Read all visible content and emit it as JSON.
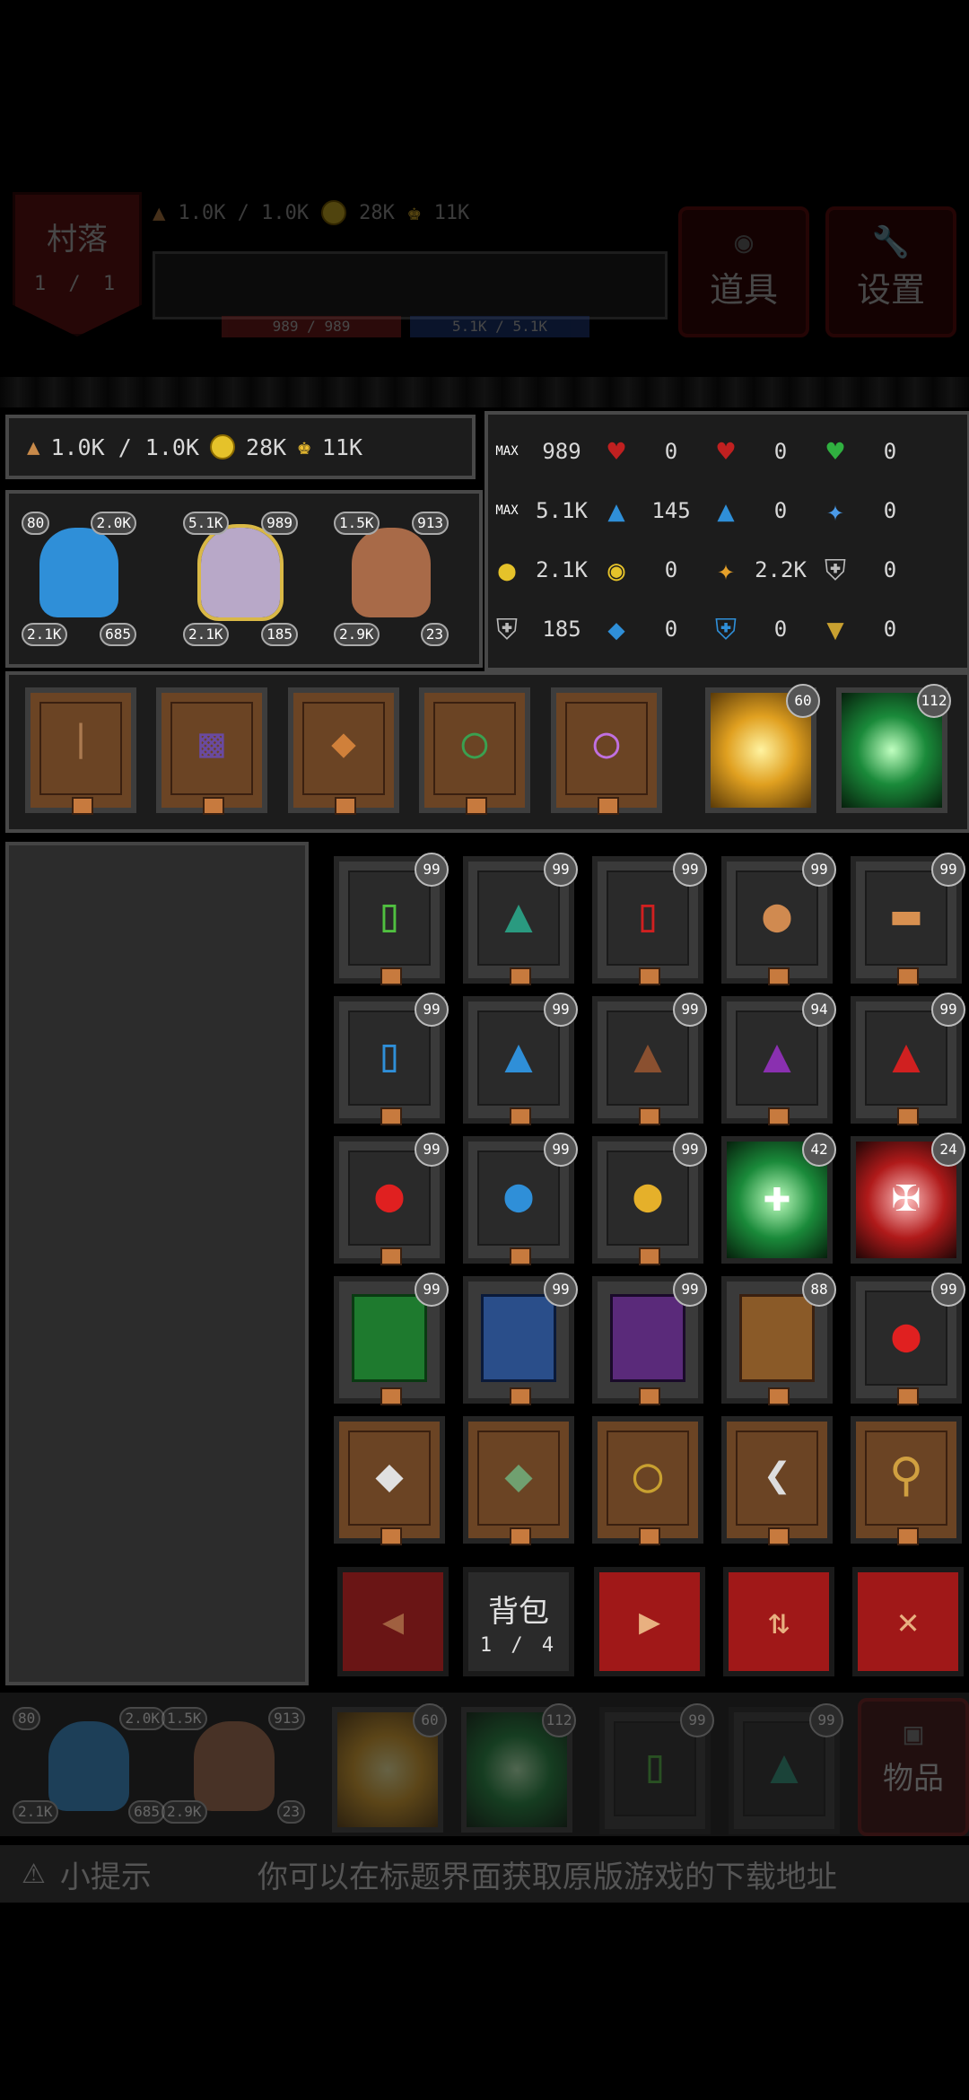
{
  "hud": {
    "village_label": "村落",
    "village_progress": "1 / 1",
    "food": "1.0K / 1.0K",
    "gold": "28K",
    "crowns": "11K",
    "hp": "989 / 989",
    "mp": "5.1K / 5.1K",
    "items_button": "道具",
    "settings_button": "设置"
  },
  "resources": {
    "food": "1.0K / 1.0K",
    "gold": "28K",
    "crowns": "11K"
  },
  "heroes": [
    {
      "tl": "80",
      "tr": "2.0K",
      "bl": "2.1K",
      "br": "685",
      "color": "#2f8fd8"
    },
    {
      "tl": "5.1K",
      "tr": "989",
      "bl": "2.1K",
      "br": "185",
      "color": "#b8a8c8"
    },
    {
      "tl": "1.5K",
      "tr": "913",
      "bl": "2.9K",
      "br": "23",
      "color": "#a86a48"
    }
  ],
  "stats": {
    "r1": {
      "a": "989",
      "b": "0",
      "c": "0",
      "d": "0",
      "max": "MAX"
    },
    "r2": {
      "a": "5.1K",
      "b": "145",
      "c": "0",
      "d": "0",
      "max": "MAX"
    },
    "r3": {
      "a": "2.1K",
      "b": "0",
      "c": "2.2K",
      "d": "0"
    },
    "r4": {
      "a": "185",
      "b": "0",
      "c": "0",
      "d": "0"
    }
  },
  "equipment": {
    "skill1_count": "60",
    "skill2_count": "112"
  },
  "inventory": {
    "counts": [
      "99",
      "99",
      "99",
      "99",
      "99",
      "99",
      "99",
      "99",
      "94",
      "99",
      "99",
      "99",
      "99",
      "42",
      "24",
      "99",
      "99",
      "99",
      "88",
      "99"
    ]
  },
  "nav": {
    "bag_label": "背包",
    "bag_page": "1 / 4"
  },
  "bottom": {
    "hero1_tl": "80",
    "hero1_tr": "2.0K",
    "hero1_bl": "2.1K",
    "hero1_br": "685",
    "hero2_tl": "1.5K",
    "hero2_tr": "913",
    "hero2_bl": "2.9K",
    "hero2_br": "23",
    "s1": "60",
    "s2": "112",
    "i1": "99",
    "i2": "99",
    "items_label": "物品"
  },
  "tip": {
    "label": "小提示",
    "text": "你可以在标题界面获取原版游戏的下载地址"
  }
}
